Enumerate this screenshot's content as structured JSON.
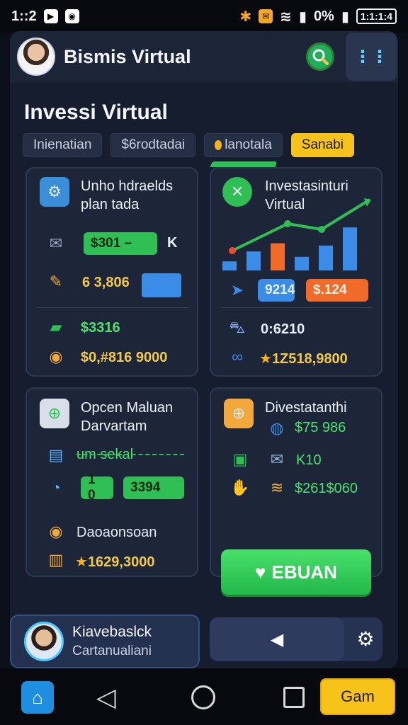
{
  "statusbar": {
    "time": "1::2",
    "battery_text": "0%",
    "battery_label": "1:1:1:4"
  },
  "header": {
    "app_title": "Bismis Virtual"
  },
  "page": {
    "title": "Invessi Virtual"
  },
  "tabs": [
    {
      "label": "Inienatian"
    },
    {
      "label": "$6rodtadai"
    },
    {
      "label": "lanotala"
    },
    {
      "label": "Sanabi"
    }
  ],
  "card1": {
    "title_line1": "Unho hdraelds",
    "title_line2": "plan tada",
    "pill1": "$301 –",
    "pill1_suffix": "K",
    "value2": "6 3,806",
    "value3": "$3316",
    "value4": "$0,#816 9000"
  },
  "card2": {
    "title_line1": "Investasinturi",
    "title_line2": "Virtual",
    "pill_blue": "9214",
    "pill_orange": "$.124",
    "value1": "0:6210",
    "value2": "1Z518,9800",
    "bars": [
      0.2,
      0.42,
      0.6,
      0.3,
      0.55,
      0.95
    ]
  },
  "card3": {
    "title_line1": "Opcen Maluan",
    "title_line2": "Darvartam",
    "chart_label": "um sekal",
    "pill_small": "1 0",
    "pill_value": "3394",
    "value1": "Daoaonsoan",
    "value2": "1629,3000"
  },
  "card4": {
    "title": "Divestatanthi",
    "value1": "$75 986",
    "value2": "K10",
    "value3": "$261$060",
    "cta_label": "EBUAN"
  },
  "profile": {
    "name": "Kiavebaslck",
    "role": "Cartanualiani"
  },
  "sysnav": {
    "game_label": "Gam"
  },
  "colors": {
    "accent_green": "#2fbf54",
    "accent_yellow": "#f7c21a",
    "background": "#161d2e"
  }
}
